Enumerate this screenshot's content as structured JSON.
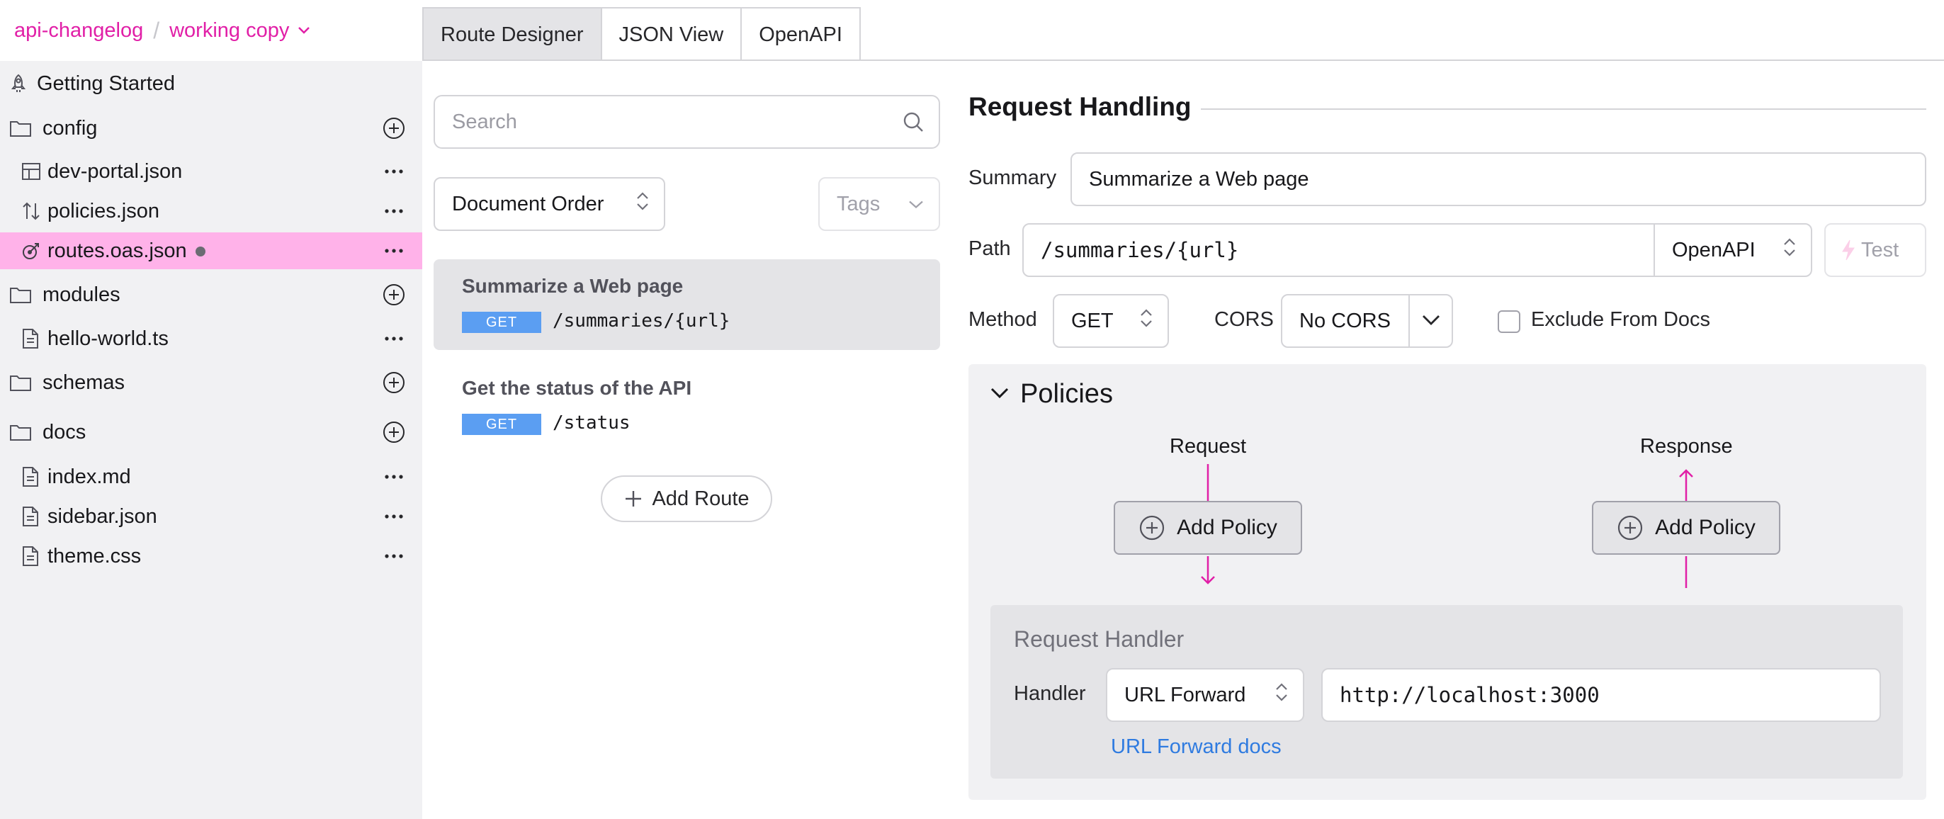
{
  "breadcrumb": {
    "project": "api-changelog",
    "separator": "/",
    "branch": "working copy"
  },
  "sidebar": {
    "items": [
      {
        "label": "Getting Started"
      },
      {
        "label": "config"
      },
      {
        "label": "dev-portal.json"
      },
      {
        "label": "policies.json"
      },
      {
        "label": "routes.oas.json"
      },
      {
        "label": "modules"
      },
      {
        "label": "hello-world.ts"
      },
      {
        "label": "schemas"
      },
      {
        "label": "docs"
      },
      {
        "label": "index.md"
      },
      {
        "label": "sidebar.json"
      },
      {
        "label": "theme.css"
      }
    ]
  },
  "tabs": [
    {
      "label": "Route Designer"
    },
    {
      "label": "JSON View"
    },
    {
      "label": "OpenAPI"
    }
  ],
  "route_list": {
    "search_placeholder": "Search",
    "sort": "Document Order",
    "tags_placeholder": "Tags",
    "routes": [
      {
        "title": "Summarize a Web page",
        "method": "GET",
        "path": "/summaries/{url}"
      },
      {
        "title": "Get the status of the API",
        "method": "GET",
        "path": "/status"
      }
    ],
    "add_route": "Add Route"
  },
  "request_handling": {
    "title": "Request Handling",
    "summary_label": "Summary",
    "summary_value": "Summarize a Web page",
    "path_label": "Path",
    "path_value": "/summaries/{url}",
    "path_mode": "OpenAPI",
    "test_label": "Test",
    "method_label": "Method",
    "method_value": "GET",
    "cors_label": "CORS",
    "cors_value": "No CORS",
    "exclude_label": "Exclude From Docs"
  },
  "policies": {
    "title": "Policies",
    "request_label": "Request",
    "response_label": "Response",
    "add_policy": "Add Policy"
  },
  "handler": {
    "title": "Request Handler",
    "label": "Handler",
    "type": "URL Forward",
    "url": "http://localhost:3000",
    "docs_link": "URL Forward docs"
  },
  "colors": {
    "accent": "#e11fa7",
    "active_row": "#ffb2e9",
    "get_badge": "#5b9ef2",
    "link": "#2f7be0"
  }
}
